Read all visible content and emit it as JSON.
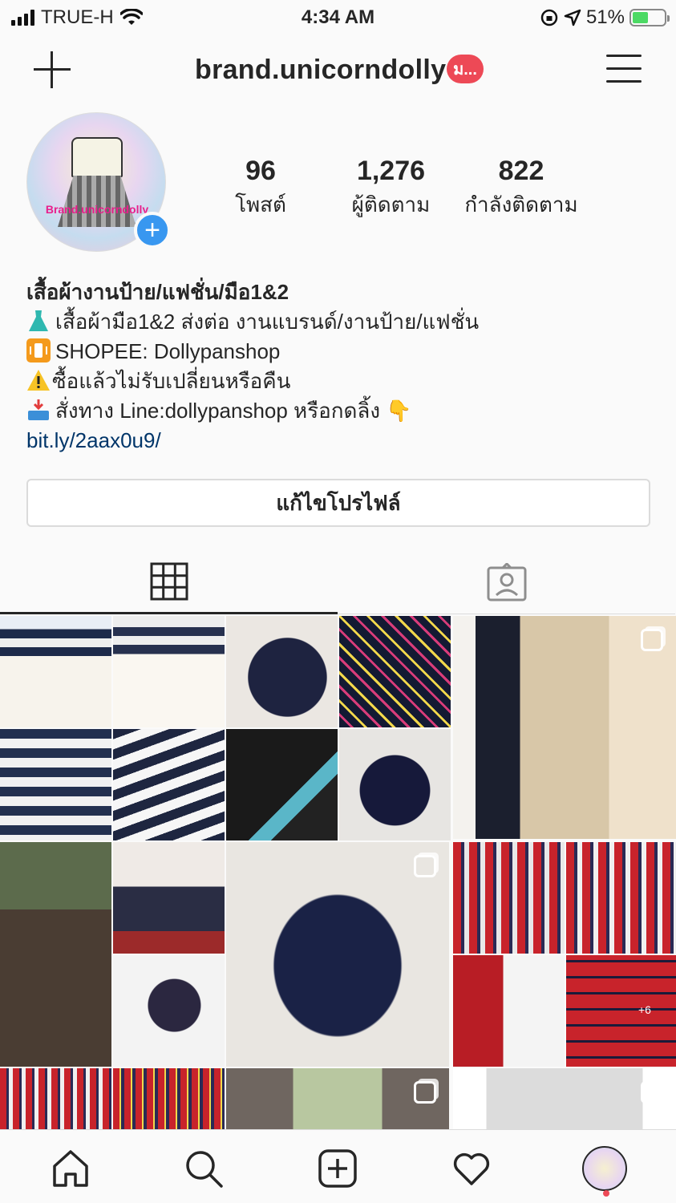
{
  "status_bar": {
    "carrier": "TRUE-H",
    "time": "4:34 AM",
    "battery_percent": "51%",
    "battery_level": 0.51,
    "icons": [
      "signal-icon",
      "wifi-icon",
      "rotation-lock-icon",
      "location-arrow-icon",
      "battery-charging-icon"
    ]
  },
  "header": {
    "username": "brand.unicorndolly",
    "badge": "ม...",
    "icons": [
      "plus-icon",
      "hamburger-menu-icon"
    ]
  },
  "profile": {
    "avatar_text": "Brand.unicorndolly",
    "stats": [
      {
        "value": "96",
        "label": "โพสต์"
      },
      {
        "value": "1,276",
        "label": "ผู้ติดตาม"
      },
      {
        "value": "822",
        "label": "กำลังติดตาม"
      }
    ],
    "bio": {
      "name": "เสื้อผ้างานป้าย/แฟชั่น/มือ1&2",
      "line1": "เสื้อผ้ามือ1&2 ส่งต่อ งานแบรนด์/งานป้าย/แฟชั่น",
      "line2": "SHOPEE: Dollypanshop",
      "line3": "ซื้อแล้วไม่รับเปลี่ยนหรือคืน",
      "line4": "สั่งทาง Line:dollypanshop หรือกดลิ้ง 👇",
      "link": "bit.ly/2aax0u9/"
    },
    "edit_button": "แก้ไขโปรไฟล์"
  },
  "tabs": [
    "grid-icon",
    "tagged-person-icon"
  ],
  "colors": {
    "accent_blue": "#3897f0",
    "badge_red": "#ed4956",
    "link": "#003569",
    "text": "#262626"
  },
  "photos": [
    {
      "name": "photo-striped-dress-front"
    },
    {
      "name": "photo-striped-dress-side"
    },
    {
      "name": "photo-print-dress"
    },
    {
      "name": "photo-print-dress-closeup"
    },
    {
      "name": "photo-cat-print-dress",
      "multi": true
    },
    {
      "name": "photo-striped-floral-top"
    },
    {
      "name": "photo-striped-top-detail"
    },
    {
      "name": "photo-print-dress-label"
    },
    {
      "name": "photo-print-dress-tag"
    },
    {
      "name": "photo-model-coat"
    },
    {
      "name": "photo-model-cat"
    },
    {
      "name": "photo-floral-dress-hanger"
    },
    {
      "name": "photo-floral-dress-long",
      "multi": true
    },
    {
      "name": "photo-plaid-dress-front"
    },
    {
      "name": "photo-plaid-dress-back"
    },
    {
      "name": "photo-plaid-collar"
    },
    {
      "name": "photo-plaid-detail",
      "count": "+6"
    },
    {
      "name": "photo-plaid-top-1"
    },
    {
      "name": "photo-plaid-top-2"
    },
    {
      "name": "photo-floral-tank",
      "multi": true
    },
    {
      "name": "photo-white-top",
      "multi": true
    }
  ],
  "bottom_nav": [
    "home-icon",
    "search-icon",
    "new-post-icon",
    "activity-heart-icon",
    "profile-avatar-icon"
  ]
}
